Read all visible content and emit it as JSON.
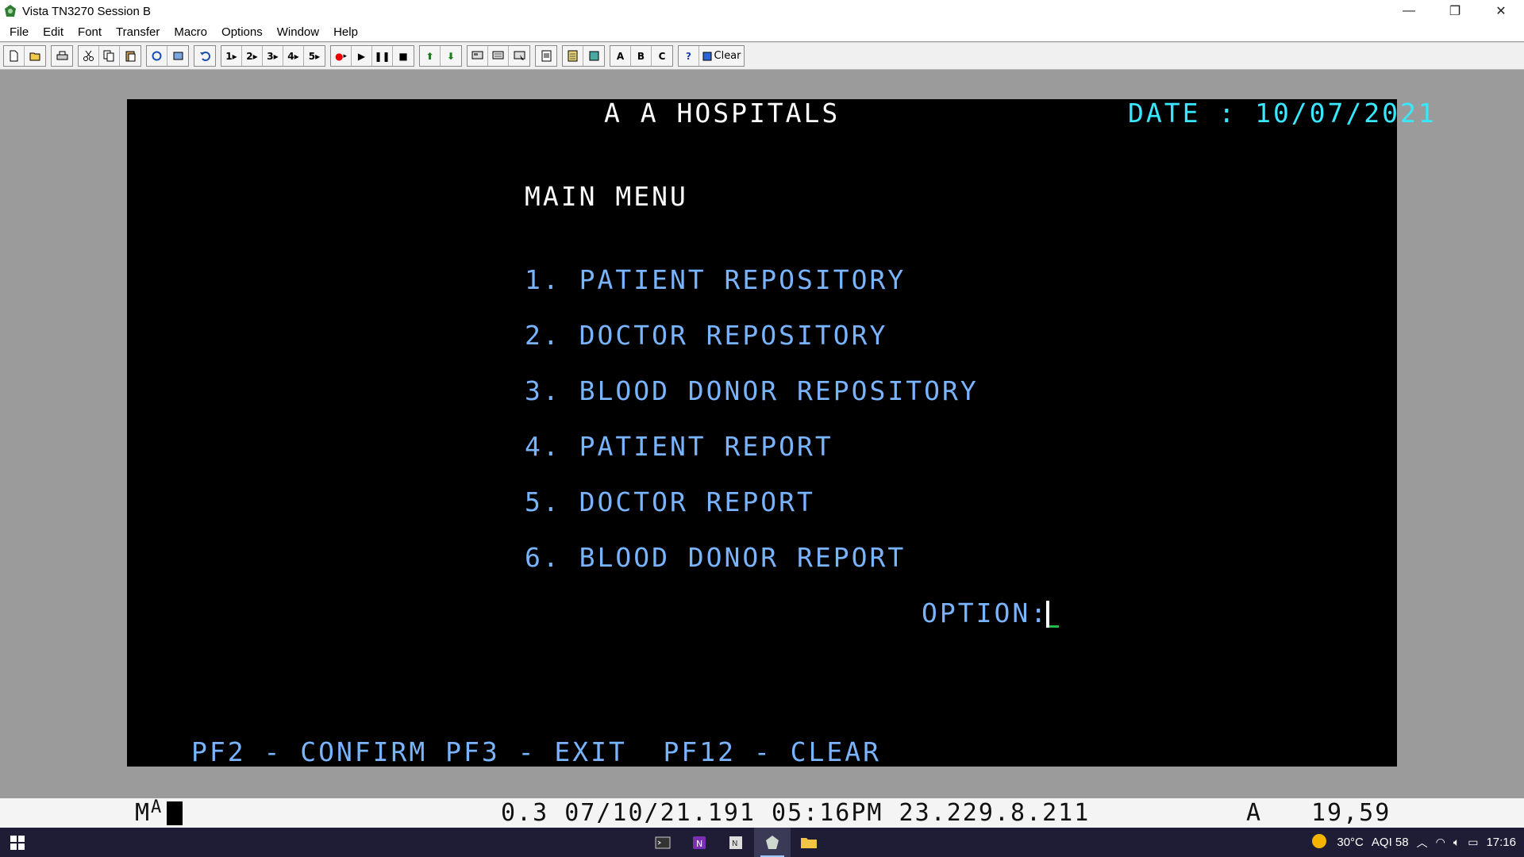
{
  "window": {
    "title": "Vista TN3270 Session B",
    "controls": [
      "—",
      "❐",
      "✕"
    ]
  },
  "menu": [
    "File",
    "Edit",
    "Font",
    "Transfer",
    "Macro",
    "Options",
    "Window",
    "Help"
  ],
  "toolbar": {
    "macro_buttons": [
      "1",
      "2",
      "3",
      "4",
      "5"
    ],
    "session_buttons": [
      "A",
      "B",
      "C"
    ],
    "help_label": "?",
    "clear_label": "Clear"
  },
  "screen": {
    "header": "A A HOSPITALS",
    "date": "DATE : 10/07/2021",
    "menu_title": "MAIN MENU",
    "options": [
      "1. PATIENT REPOSITORY",
      "2. DOCTOR REPOSITORY",
      "3. BLOOD DONOR REPOSITORY",
      "4. PATIENT REPORT",
      "5. DOCTOR REPORT",
      "6. BLOOD DONOR REPORT"
    ],
    "option_prompt": "OPTION:",
    "pf_keys": "PF2 - CONFIRM PF3 - EXIT  PF12 - CLEAR"
  },
  "status": {
    "indicator": "M",
    "indicator_super": "A",
    "info": "0.3 07/10/21.191 05:16PM 23.229.8.211",
    "mode": "A",
    "cursor_pos": "19,59"
  },
  "taskbar": {
    "temperature": "30°C",
    "aqi": "AQI 58",
    "time": "17:16"
  },
  "colors": {
    "terminal_bg": "#000000",
    "field_blue": "#78b4ff",
    "date_cyan": "#38e8ff",
    "taskbar": "#1f1d35"
  }
}
